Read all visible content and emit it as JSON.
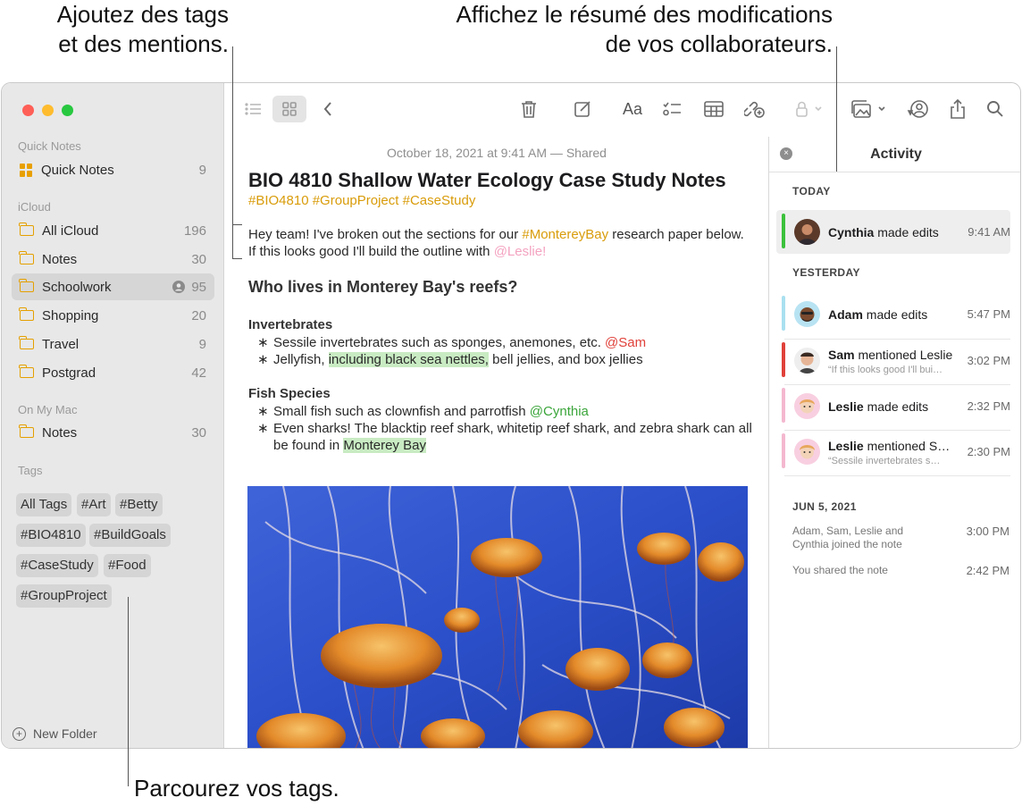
{
  "callouts": {
    "tags_mentions": [
      "Ajoutez des tags",
      "et des mentions."
    ],
    "activity": [
      "Affichez le résumé des modifications",
      "de vos collaborateurs."
    ],
    "browse_tags": "Parcourez vos tags."
  },
  "sidebar": {
    "sections": [
      {
        "heading": "Quick Notes",
        "items": [
          {
            "label": "Quick Notes",
            "count": "9",
            "icon": "quick-notes-grid-icon"
          }
        ]
      },
      {
        "heading": "iCloud",
        "items": [
          {
            "label": "All iCloud",
            "count": "196",
            "icon": "folder-icon"
          },
          {
            "label": "Notes",
            "count": "30",
            "icon": "folder-icon"
          },
          {
            "label": "Schoolwork",
            "count": "95",
            "icon": "folder-icon",
            "selected": true,
            "shared": true
          },
          {
            "label": "Shopping",
            "count": "20",
            "icon": "folder-icon"
          },
          {
            "label": "Travel",
            "count": "9",
            "icon": "folder-icon"
          },
          {
            "label": "Postgrad",
            "count": "42",
            "icon": "folder-icon"
          }
        ]
      },
      {
        "heading": "On My Mac",
        "items": [
          {
            "label": "Notes",
            "count": "30",
            "icon": "folder-icon"
          }
        ]
      }
    ],
    "tags_heading": "Tags",
    "tags": [
      "All Tags",
      "#Art",
      "#Betty",
      "#BIO4810",
      "#BuildGoals",
      "#CaseStudy",
      "#Food",
      "#GroupProject"
    ],
    "new_folder": "New Folder"
  },
  "toolbar": {
    "icons": [
      "list-view-icon",
      "gallery-view-icon",
      "back-chevron-icon",
      "trash-icon",
      "compose-icon",
      "format-text-icon",
      "checklist-icon",
      "table-icon",
      "collaborate-link-icon",
      "lock-icon",
      "media-icon",
      "activity-collab-icon",
      "share-icon",
      "search-icon"
    ],
    "format_label": "Aa"
  },
  "note": {
    "date": "October 18, 2021 at 9:41 AM — Shared",
    "title": "BIO 4810 Shallow Water Ecology Case Study Notes",
    "tags": "#BIO4810 #GroupProject #CaseStudy",
    "intro": {
      "t1": "Hey team! I've broken out the sections for our ",
      "tag": "#MontereyBay",
      "t2": " research paper below. If this looks good I'll build the outline with ",
      "mention": "@Leslie!"
    },
    "heading": "Who lives in Monterey Bay's reefs?",
    "invertebrates": {
      "heading": "Invertebrates",
      "b1": {
        "text": "Sessile invertebrates such as sponges, anemones, etc. ",
        "mention": "@Sam"
      },
      "b2": {
        "t1": "Jellyfish, ",
        "hl": "including black sea nettles,",
        "t2": " bell jellies, and box jellies"
      }
    },
    "fish": {
      "heading": "Fish Species",
      "b1": {
        "text": "Small fish such as clownfish and parrotfish ",
        "mention": "@Cynthia"
      },
      "b2": {
        "text": "Even sharks! The blacktip reef shark, whitetip reef shark, and zebra shark can all be found in ",
        "hl": "Monterey Bay"
      }
    },
    "bullet": "∗"
  },
  "activity": {
    "title": "Activity",
    "close": "×",
    "today": "TODAY",
    "yesterday": "YESTERDAY",
    "older": "JUN 5, 2021",
    "today_items": [
      {
        "name": "Cynthia",
        "action": " made edits",
        "time": "9:41 AM",
        "color": "#3cc13c"
      }
    ],
    "yesterday_items": [
      {
        "name": "Adam",
        "action": " made edits",
        "sub": "",
        "time": "5:47 PM",
        "color": "#a9e0f0"
      },
      {
        "name": "Sam",
        "action": " mentioned Leslie",
        "sub": "“If this looks good I'll build the outline”",
        "time": "3:02 PM",
        "color": "#e0413a"
      },
      {
        "name": "Leslie",
        "action": " made edits",
        "sub": "",
        "time": "2:32 PM",
        "color": "#f4b8cf"
      },
      {
        "name": "Leslie",
        "action": " mentioned Sam",
        "sub": "“Sessile invertebrates such as sponges”",
        "time": "2:30 PM",
        "color": "#f4b8cf"
      }
    ],
    "older_items": [
      {
        "text1": "Adam, Sam, Leslie and",
        "text2": "Cynthia joined the note",
        "time": "3:00 PM"
      },
      {
        "text1": "You shared the note",
        "time": "2:42 PM"
      }
    ]
  }
}
